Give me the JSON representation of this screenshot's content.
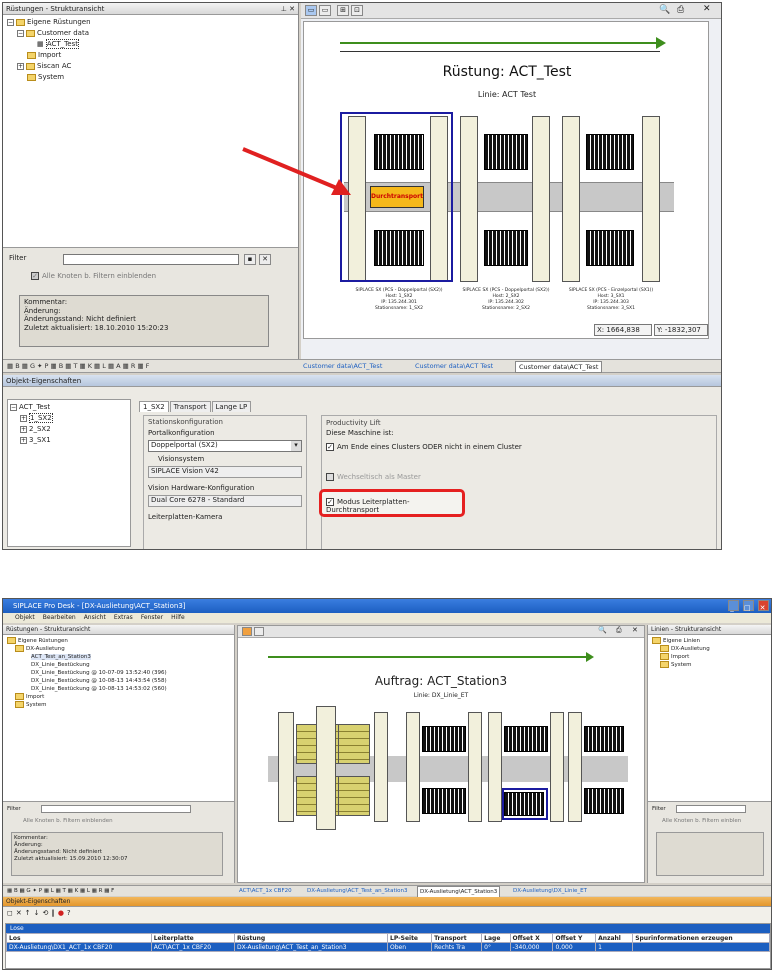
{
  "top": {
    "tree_title": "Rüstungen - Strukturansicht",
    "tree": [
      "Eigene Rüstungen",
      "Customer data",
      "ACT_Test",
      "Import",
      "Siscan AC",
      "System"
    ],
    "filter_label": "Filter",
    "show_nodes": "Alle Knoten b. Filtern einblenden",
    "comment": [
      "Kommentar:",
      "Änderung:",
      "Änderungsstand: Nicht definiert",
      "Zuletzt aktualisiert: 18.10.2010 15:20:23"
    ],
    "diagram_title": "Rüstung: ACT_Test",
    "diagram_line": "Linie: ACT Test",
    "transport_label": "Durchtransport",
    "stations": [
      {
        "head": "SIPLACE SX (PCS - Doppelportal (SX2))",
        "lines": [
          "Host: 1_SX2",
          "IP: 135.244.301",
          "Stationsname: 1_SX2"
        ]
      },
      {
        "head": "SIPLACE SX (PCS - Doppelportal (SX2))",
        "lines": [
          "Host: 2_SX2",
          "IP: 135.244.302",
          "Stationsname: 2_SX2"
        ]
      },
      {
        "head": "SIPLACE SX (PCS - Einzelportal (SX1))",
        "lines": [
          "Host: 3_SX1",
          "IP: 135.244.303",
          "Stationsname: 3_SX1"
        ]
      }
    ],
    "coord_x": "X: 1664,838",
    "coord_y": "Y: -1832,307",
    "doc_tabs": [
      "Customer data\\ACT_Test",
      "Customer data\\ACT Test",
      "Customer data\\ACT_Test"
    ],
    "props_title": "Objekt-Eigenschaften",
    "obj_tree": [
      "ACT_Test",
      "1_SX2",
      "2_SX2",
      "3_SX1"
    ],
    "prop_tabs": [
      "1_SX2",
      "Transport",
      "Lange LP"
    ],
    "station_cfg": "Stationskonfiguration",
    "portal_label": "Portalkonfiguration",
    "portal_value": "Doppelportal (SX2)",
    "vision_label": "Visionsystem",
    "vision_value": "SIPLACE Vision V42",
    "hw_label": "Vision Hardware-Konfiguration",
    "hw_value": "Dual Core 6278 - Standard",
    "cam_label": "Leiterplatten-Kamera",
    "productivity": "Productivity Lift",
    "machine_is": "Diese Maschine ist:",
    "cluster_opt": "Am Ende eines Clusters ODER nicht in einem Cluster",
    "disabled_opt": "Wechseltisch als Master",
    "mode_opt": "Modus Leiterplatten-Durchtransport"
  },
  "bottom": {
    "app_title": "SIPLACE Pro Desk - [DX-Auslietung\\ACT_Station3]",
    "menu": [
      "Objekt",
      "Bearbeiten",
      "Ansicht",
      "Extras",
      "Fenster",
      "Hilfe"
    ],
    "left_title": "Rüstungen - Strukturansicht",
    "left_tree": [
      "Eigene Rüstungen",
      "DX-Auslietung",
      "ACT_Test_an_Station3",
      "DX_Linie_Bestückung",
      "DX_Linie_Bestückung @ 10-07-09 13:52:40 (396)",
      "DX_Linie_Bestückung @ 10-08-13 14:43:54 (558)",
      "DX_Linie_Bestückung @ 10-08-13 14:53:02 (560)",
      "Import",
      "System"
    ],
    "filter_label": "Filter",
    "show_nodes": "Alle Knoten b. Filtern einblenden",
    "comment": [
      "Kommentar:",
      "Änderung:",
      "Änderungsstand: Nicht definiert",
      "Zuletzt aktualisiert: 15.09.2010 12:30:07"
    ],
    "diagram_title": "Auftrag: ACT_Station3",
    "diagram_line": "Linie: DX_Linie_ET",
    "right_title": "Linien - Strukturansicht",
    "right_tree": [
      "Eigene Linien",
      "DX-Auslietung",
      "Import",
      "System"
    ],
    "right_show": "Alle Knoten b. Filtern einblen",
    "doc_tabs": [
      "ACT\\ACT_1x CBF20",
      "DX-Auslietung\\ACT_Test_an_Station3",
      "DX-Auslietung\\ACT_Station3",
      "DX-Auslietung\\DX_Linie_ET"
    ],
    "props_title": "Objekt-Eigenschaften",
    "lose": "Lose",
    "cols": [
      "Los",
      "Leiterplatte",
      "Rüstung",
      "LP-Seite",
      "Transport",
      "Lage",
      "Offset X",
      "Offset Y",
      "Anzahl",
      "Spurinformationen erzeugen"
    ],
    "row": [
      "DX-Auslietung\\DX1_ACT_1x CBF20",
      "ACT\\ACT_1x CBF20",
      "DX-Auslietung\\ACT_Test_an_Station3",
      "Oben",
      "Rechts Tra",
      "0°",
      "-340,000",
      "0,000",
      "1",
      ""
    ]
  },
  "colors": {
    "arrow_red": "#e02020",
    "highlight_red": "#e52020",
    "title_blue": "#1c5fc1",
    "green_line": "#3e8e1d"
  }
}
